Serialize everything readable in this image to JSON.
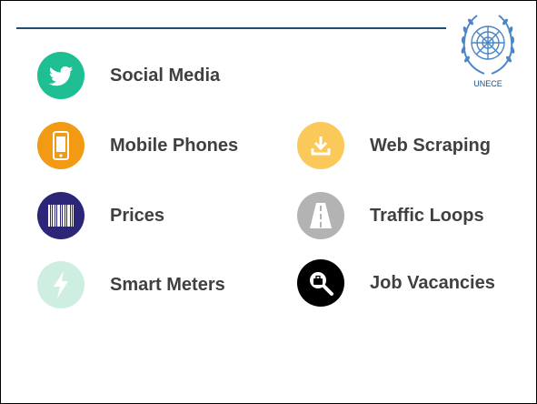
{
  "logo": {
    "text": "UNECE"
  },
  "items": [
    {
      "label": "Social Media",
      "icon": "twitter-bird-icon",
      "color": "#1dbf93"
    },
    {
      "label": "Mobile Phones",
      "icon": "mobile-phone-icon",
      "color": "#f29a14"
    },
    {
      "label": "Web Scraping",
      "icon": "download-icon",
      "color": "#fbc85a"
    },
    {
      "label": "Prices",
      "icon": "barcode-icon",
      "color": "#2b2677"
    },
    {
      "label": "Traffic Loops",
      "icon": "road-icon",
      "color": "#b3b3b3"
    },
    {
      "label": "Smart Meters",
      "icon": "lightning-bolt-icon",
      "color": "#cdeee0"
    },
    {
      "label": "Job Vacancies",
      "icon": "magnifier-briefcase-icon",
      "color": "#000000"
    }
  ]
}
